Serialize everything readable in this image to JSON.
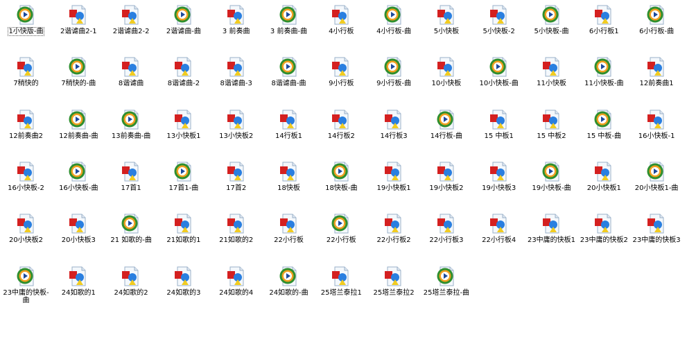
{
  "colors": {
    "page_fill": "#f4f8fc",
    "page_stroke": "#9ab0c8",
    "media_ring": "#2f8f2f",
    "media_orange": "#f0a020",
    "media_play": "#1d4a9c",
    "shape_red": "#d42020",
    "shape_blue": "#2a7fe0",
    "shape_yellow": "#f2cc20"
  },
  "files": [
    {
      "label": "1小快版-曲",
      "icon": "media-player-icon"
    },
    {
      "label": "2谐谑曲2-1",
      "icon": "audio-file-icon"
    },
    {
      "label": "2谐谑曲2-2",
      "icon": "audio-file-icon"
    },
    {
      "label": "2谐谑曲-曲",
      "icon": "media-player-icon"
    },
    {
      "label": "3 前奏曲",
      "icon": "audio-file-icon"
    },
    {
      "label": "3 前奏曲-曲",
      "icon": "media-player-icon"
    },
    {
      "label": "4小行板",
      "icon": "audio-file-icon"
    },
    {
      "label": "4小行板-曲",
      "icon": "media-player-icon"
    },
    {
      "label": "5小快板",
      "icon": "audio-file-icon"
    },
    {
      "label": "5小快板-2",
      "icon": "audio-file-icon"
    },
    {
      "label": "5小快板-曲",
      "icon": "media-player-icon"
    },
    {
      "label": "6小行板1",
      "icon": "audio-file-icon"
    },
    {
      "label": "6小行板-曲",
      "icon": "media-player-icon"
    },
    {
      "label": "7稍快的",
      "icon": "audio-file-icon"
    },
    {
      "label": "7稍快的-曲",
      "icon": "media-player-icon"
    },
    {
      "label": "8谐谑曲",
      "icon": "audio-file-icon"
    },
    {
      "label": "8谐谑曲-2",
      "icon": "audio-file-icon"
    },
    {
      "label": "8谐谑曲-3",
      "icon": "audio-file-icon"
    },
    {
      "label": "8谐谑曲-曲",
      "icon": "media-player-icon"
    },
    {
      "label": "9小行板",
      "icon": "audio-file-icon"
    },
    {
      "label": "9小行板-曲",
      "icon": "media-player-icon"
    },
    {
      "label": "10小快板",
      "icon": "audio-file-icon"
    },
    {
      "label": "10小快板-曲",
      "icon": "media-player-icon"
    },
    {
      "label": "11小快板",
      "icon": "audio-file-icon"
    },
    {
      "label": "11小快板-曲",
      "icon": "media-player-icon"
    },
    {
      "label": "12前奏曲1",
      "icon": "audio-file-icon"
    },
    {
      "label": "12前奏曲2",
      "icon": "audio-file-icon"
    },
    {
      "label": "12前奏曲-曲",
      "icon": "media-player-icon"
    },
    {
      "label": "13前奏曲-曲",
      "icon": "media-player-icon"
    },
    {
      "label": "13小快板1",
      "icon": "audio-file-icon"
    },
    {
      "label": "13小快板2",
      "icon": "audio-file-icon"
    },
    {
      "label": "14行板1",
      "icon": "audio-file-icon"
    },
    {
      "label": "14行板2",
      "icon": "audio-file-icon"
    },
    {
      "label": "14行板3",
      "icon": "audio-file-icon"
    },
    {
      "label": "14行板-曲",
      "icon": "media-player-icon"
    },
    {
      "label": "15 中板1",
      "icon": "audio-file-icon"
    },
    {
      "label": "15 中板2",
      "icon": "audio-file-icon"
    },
    {
      "label": "15 中板-曲",
      "icon": "media-player-icon"
    },
    {
      "label": "16小快板-1",
      "icon": "audio-file-icon"
    },
    {
      "label": "16小快板-2",
      "icon": "audio-file-icon"
    },
    {
      "label": "16小快板-曲",
      "icon": "media-player-icon"
    },
    {
      "label": "17首1",
      "icon": "audio-file-icon"
    },
    {
      "label": "17首1-曲",
      "icon": "media-player-icon"
    },
    {
      "label": "17首2",
      "icon": "audio-file-icon"
    },
    {
      "label": "18快板",
      "icon": "audio-file-icon"
    },
    {
      "label": "18快板-曲",
      "icon": "media-player-icon"
    },
    {
      "label": "19小快板1",
      "icon": "audio-file-icon"
    },
    {
      "label": "19小快板2",
      "icon": "audio-file-icon"
    },
    {
      "label": "19小快板3",
      "icon": "audio-file-icon"
    },
    {
      "label": "19小快板-曲",
      "icon": "media-player-icon"
    },
    {
      "label": "20小快板1",
      "icon": "audio-file-icon"
    },
    {
      "label": "20小快板1-曲",
      "icon": "media-player-icon"
    },
    {
      "label": "20小快板2",
      "icon": "audio-file-icon"
    },
    {
      "label": "20小快板3",
      "icon": "audio-file-icon"
    },
    {
      "label": "21 如歌的-曲",
      "icon": "media-player-icon"
    },
    {
      "label": "21如歌的1",
      "icon": "audio-file-icon"
    },
    {
      "label": "21如歌的2",
      "icon": "audio-file-icon"
    },
    {
      "label": "22小行板",
      "icon": "audio-file-icon"
    },
    {
      "label": "22小行板",
      "icon": "media-player-icon"
    },
    {
      "label": "22小行板2",
      "icon": "audio-file-icon"
    },
    {
      "label": "22小行板3",
      "icon": "audio-file-icon"
    },
    {
      "label": "22小行板4",
      "icon": "audio-file-icon"
    },
    {
      "label": "23中庸的快板1",
      "icon": "audio-file-icon"
    },
    {
      "label": "23中庸的快板2",
      "icon": "audio-file-icon"
    },
    {
      "label": "23中庸的快板3",
      "icon": "audio-file-icon"
    },
    {
      "label": "23中庸的快板-曲",
      "icon": "media-player-icon"
    },
    {
      "label": "24如歌的1",
      "icon": "audio-file-icon"
    },
    {
      "label": "24如歌的2",
      "icon": "audio-file-icon"
    },
    {
      "label": "24如歌的3",
      "icon": "audio-file-icon"
    },
    {
      "label": "24如歌的4",
      "icon": "audio-file-icon"
    },
    {
      "label": "24如歌的-曲",
      "icon": "media-player-icon"
    },
    {
      "label": "25塔兰泰拉1",
      "icon": "audio-file-icon"
    },
    {
      "label": "25塔兰泰拉2",
      "icon": "audio-file-icon"
    },
    {
      "label": "25塔兰泰拉-曲",
      "icon": "media-player-icon"
    }
  ]
}
